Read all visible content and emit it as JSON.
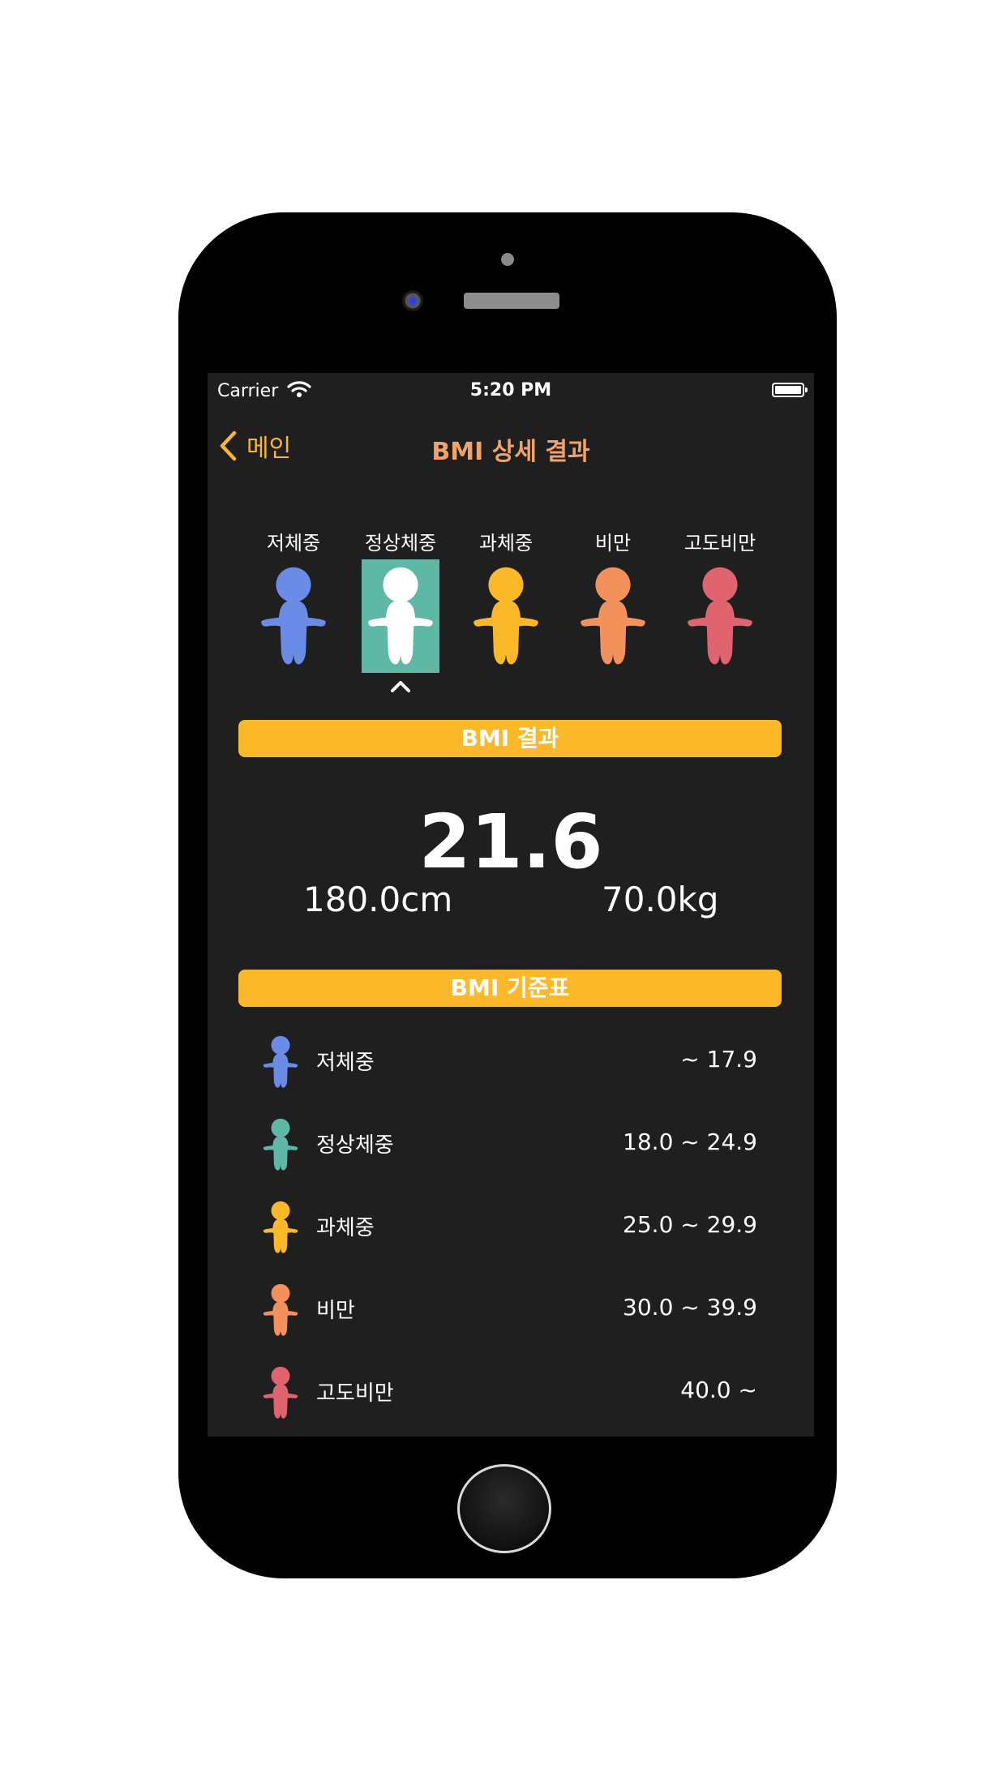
{
  "status_bar": {
    "carrier": "Carrier",
    "time": "5:20 PM"
  },
  "nav": {
    "back_label": "메인",
    "title": "BMI 상세 결과"
  },
  "categories": [
    {
      "label": "저체중",
      "color": "#6a8be6"
    },
    {
      "label": "정상체중",
      "color": "#ffffff",
      "selected": true
    },
    {
      "label": "과체중",
      "color": "#fbb829"
    },
    {
      "label": "비만",
      "color": "#f3915c"
    },
    {
      "label": "고도비만",
      "color": "#e06470"
    }
  ],
  "result": {
    "section_title": "BMI 결과",
    "bmi": "21.6",
    "height": "180.0cm",
    "weight": "70.0kg"
  },
  "table": {
    "section_title": "BMI 기준표",
    "rows": [
      {
        "label": "저체중",
        "range": "~ 17.9",
        "color": "#6a8be6"
      },
      {
        "label": "정상체중",
        "range": "18.0 ~ 24.9",
        "color": "#5fb7a6"
      },
      {
        "label": "과체중",
        "range": "25.0 ~ 29.9",
        "color": "#fbb829"
      },
      {
        "label": "비만",
        "range": "30.0 ~ 39.9",
        "color": "#f3915c"
      },
      {
        "label": "고도비만",
        "range": "40.0 ~",
        "color": "#e06470"
      }
    ]
  },
  "colors": {
    "accent": "#fbb829",
    "selected_bg": "#5fb7a6",
    "title": "#f2a36b"
  },
  "icons": {
    "back": "chevron-left-icon",
    "caret": "caret-up-icon",
    "figure": "person-icon"
  }
}
